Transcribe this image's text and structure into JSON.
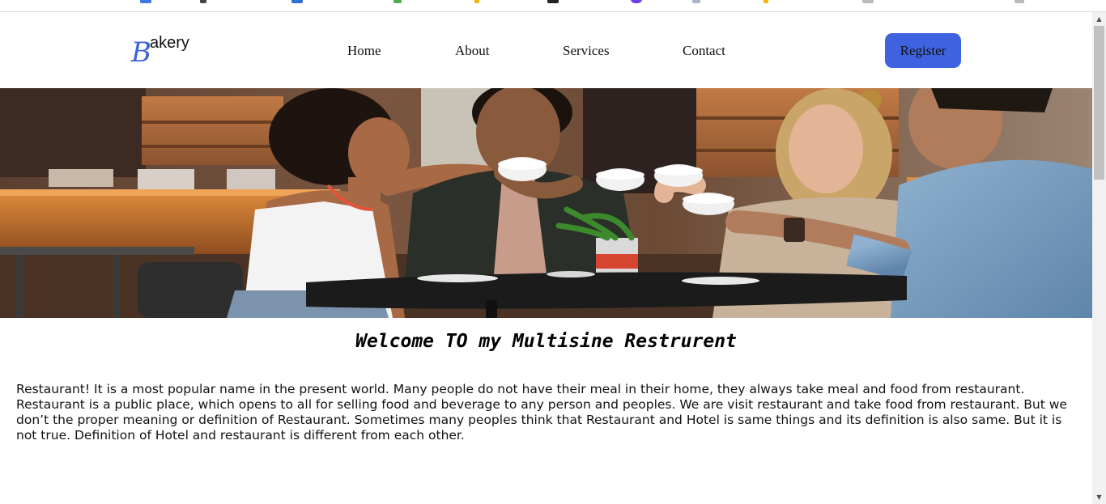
{
  "brand": {
    "initial": "B",
    "rest": "akery",
    "initial_color": "#3f63d9"
  },
  "nav": {
    "items": [
      {
        "label": "Home"
      },
      {
        "label": "About"
      },
      {
        "label": "Services"
      },
      {
        "label": "Contact"
      }
    ],
    "register_label": "Register",
    "register_color": "#3f63e0"
  },
  "hero": {
    "image": "friends-toasting-coffee-cups-in-cafe"
  },
  "content": {
    "heading": "Welcome TO my Multisine Restrurent",
    "paragraph": "Restaurant! It is a most popular name in the present world. Many people do not have their meal in their home, they always take meal and food from restaurant. Restaurant is a public place, which opens to all for selling food and beverage to any person and peoples. We are visit restaurant and take food from restaurant. But we don’t the proper meaning or definition of Restaurant. Sometimes many peoples think that Restaurant and Hotel is same things and its definition is also same. But it is not true. Definition of Hotel and restaurant is different from each other."
  },
  "scrollbar": {
    "up_icon": "scroll-up-arrow",
    "down_icon": "scroll-down-arrow"
  }
}
